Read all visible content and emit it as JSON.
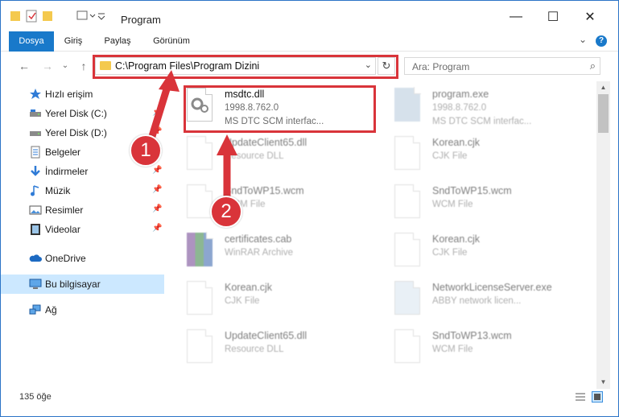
{
  "window": {
    "title": "Program",
    "minimize": "—",
    "maximize": "☐",
    "close": "✕"
  },
  "ribbon": {
    "tabs": [
      "Dosya",
      "Giriş",
      "Paylaş",
      "Görünüm"
    ],
    "active_color": "#1979ca",
    "expand_label": "⌄",
    "help_label": "?"
  },
  "nav": {
    "back": "←",
    "forward": "→",
    "recent": "⌄",
    "up": "↑",
    "address": "C:\\Program Files\\Program Dizini",
    "address_dropdown": "⌄",
    "refresh": "↻",
    "search_placeholder": "Ara: Program",
    "search_icon": "⌕"
  },
  "sidebar": {
    "items": [
      {
        "label": "Hızlı erişim",
        "icon": "star-icon",
        "pinned": false
      },
      {
        "label": "Yerel Disk (C:)",
        "icon": "drive-icon",
        "pinned": true
      },
      {
        "label": "Yerel Disk (D:)",
        "icon": "drive-icon",
        "pinned": true
      },
      {
        "label": "Belgeler",
        "icon": "document-icon",
        "pinned": true
      },
      {
        "label": "İndirmeler",
        "icon": "download-icon",
        "pinned": true
      },
      {
        "label": "Müzik",
        "icon": "music-icon",
        "pinned": true
      },
      {
        "label": "Resimler",
        "icon": "pictures-icon",
        "pinned": true
      },
      {
        "label": "Videolar",
        "icon": "video-icon",
        "pinned": true
      },
      {
        "label": "OneDrive",
        "icon": "cloud-icon",
        "pinned": false
      },
      {
        "label": "Bu bilgisayar",
        "icon": "computer-icon",
        "pinned": false,
        "selected": true
      },
      {
        "label": "Ağ",
        "icon": "network-icon",
        "pinned": false
      }
    ]
  },
  "files": [
    {
      "name": "msdtc.dll",
      "line2": "1998.8.762.0",
      "line3": "MS DTC SCM interfac...",
      "highlighted": true
    },
    {
      "name": "program.exe",
      "line2": "1998.8.762.0",
      "line3": "MS DTC SCM interfac..."
    },
    {
      "name": "UpdateClient65.dll",
      "line2": "Resource DLL",
      "line3": ""
    },
    {
      "name": "Korean.cjk",
      "line2": "CJK File",
      "line3": ""
    },
    {
      "name": "SndToWP15.wcm",
      "line2": "WCM File",
      "line3": ""
    },
    {
      "name": "SndToWP15.wcm",
      "line2": "WCM File",
      "line3": ""
    },
    {
      "name": "certificates.cab",
      "line2": "WinRAR Archive",
      "line3": ""
    },
    {
      "name": "Korean.cjk",
      "line2": "CJK File",
      "line3": ""
    },
    {
      "name": "Korean.cjk",
      "line2": "CJK File",
      "line3": ""
    },
    {
      "name": "NetworkLicenseServer.exe",
      "line2": "ABBY network licen...",
      "line3": ""
    },
    {
      "name": "UpdateClient65.dll",
      "line2": "Resource DLL",
      "line3": ""
    },
    {
      "name": "SndToWP13.wcm",
      "line2": "WCM File",
      "line3": ""
    }
  ],
  "annotations": {
    "step1": "1",
    "step2": "2",
    "color": "#d9343a"
  },
  "status": {
    "count": "135 öğe"
  }
}
